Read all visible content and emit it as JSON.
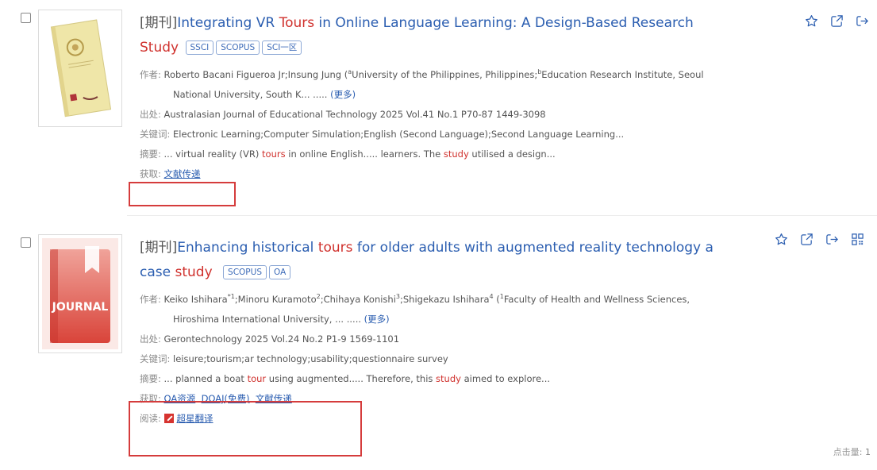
{
  "results": [
    {
      "type_tag": "[期刊]",
      "title_parts": [
        "Integrating VR ",
        "Tours",
        " in Online Language Learning: A Design-Based Research "
      ],
      "title_tail": "Study",
      "badges": [
        "SSCI",
        "SCOPUS",
        "SCI一区"
      ],
      "authors_label": "作者:",
      "authors": "Roberto Bacani Figueroa Jr;Insung Jung",
      "affil_1_sup": "a",
      "affil_1": "University of the Philippines, Philippines;",
      "affil_2_sup": "b",
      "affil_2": "Education Research Institute, Seoul",
      "affil_cont": "National University, South K... .....",
      "more": "(更多)",
      "source_label": "出处:",
      "source": "Australasian Journal of Educational Technology 2025 Vol.41 No.1 P70-87  1449-3098",
      "keywords_label": "关键词:",
      "keywords": "Electronic Learning;Computer Simulation;English (Second Language);Second Language Learning...",
      "abstract_label": "摘要:",
      "abstract_parts": [
        "... virtual reality (VR) ",
        "tours",
        " in online English..... learners. The ",
        "study",
        " utilised a design..."
      ],
      "access_label": "获取:",
      "access_links": [
        "文献传递"
      ]
    },
    {
      "type_tag": "[期刊]",
      "title_parts": [
        "Enhancing historical ",
        "tours",
        " for older adults with augmented reality technology a"
      ],
      "title_tail_parts": [
        "case ",
        "study"
      ],
      "badges": [
        "SCOPUS",
        "OA"
      ],
      "authors_label": "作者:",
      "a1": "Keiko Ishihara",
      "a1_sup": "*1",
      "a2": ";Minoru Kuramoto",
      "a2_sup": "2",
      "a3": ";Chihaya Konishi",
      "a3_sup": "3",
      "a4": ";Shigekazu Ishihara",
      "a4_sup": "4",
      "affil_open": "(",
      "affil_sup": "1",
      "affil_1": "Faculty of Health and Wellness Sciences,",
      "affil_cont": "Hiroshima International University, ... .....",
      "more": "(更多)",
      "source_label": "出处:",
      "source": "Gerontechnology 2025 Vol.24 No.2 P1-9  1569-1101",
      "keywords_label": "关键词:",
      "keywords": "leisure;tourism;ar technology;usability;questionnaire survey",
      "abstract_label": "摘要:",
      "abstract_parts": [
        "... planned a boat ",
        "tour",
        " using augmented..... Therefore, this ",
        "study",
        " aimed to explore..."
      ],
      "access_label": "获取:",
      "access_links": [
        "OA资源",
        "DOAJ(免费)",
        "文献传递"
      ],
      "read_label": "阅读:",
      "read_link": "超星翻译",
      "thumb_text": "JOURNAL",
      "clicks_label": "点击量:",
      "clicks": "1"
    }
  ],
  "colors": {
    "link": "#2a5db0",
    "highlight": "#d0312d",
    "box": "#d53c3c"
  },
  "icons": [
    "star-icon",
    "external-link-icon",
    "share-icon",
    "qr-code-icon"
  ]
}
